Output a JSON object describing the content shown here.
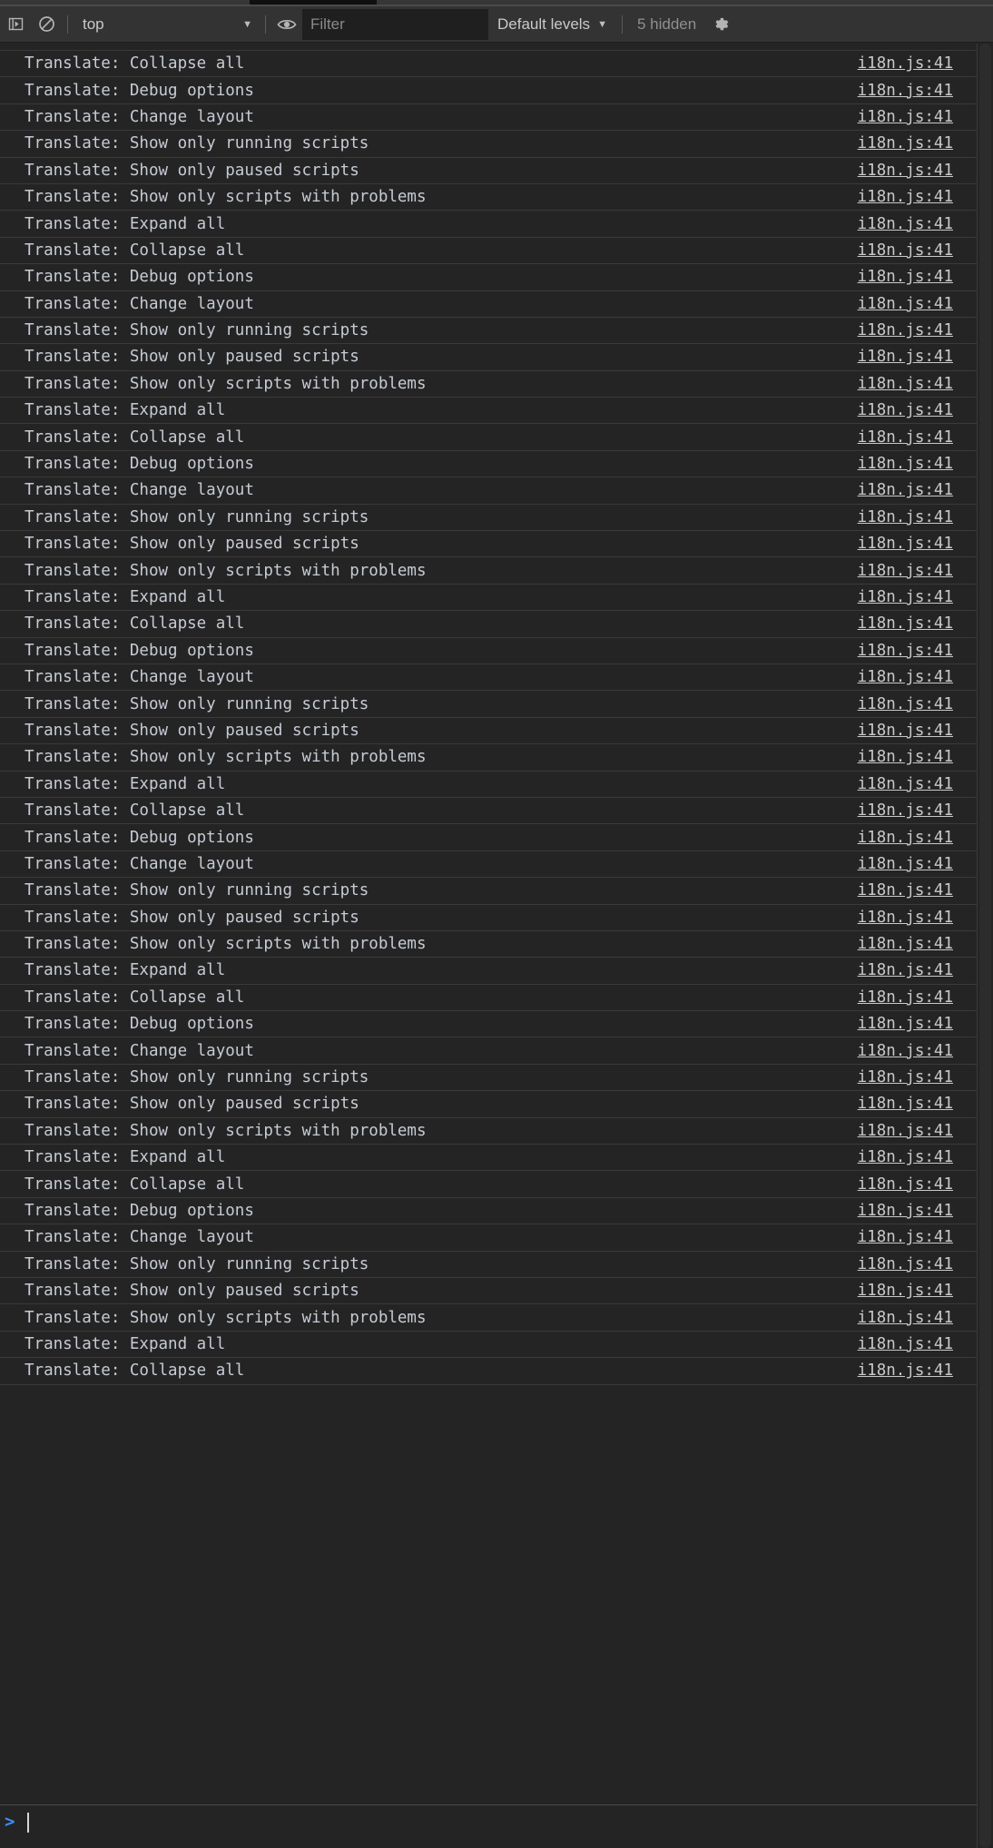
{
  "toolbar": {
    "sidebar_toggle_icon": "show-console-sidebar-icon",
    "clear_icon": "clear-console-icon",
    "context_selector": "top",
    "context_caret": "▼",
    "eye_icon": "create-live-expression-icon",
    "filter_placeholder": "Filter",
    "filter_value": "",
    "levels_label": "Default levels",
    "levels_caret": "▼",
    "hidden_label": "5 hidden",
    "settings_icon": "gear-icon"
  },
  "colors": {
    "toolbar_bg": "#333333",
    "console_bg": "#242424",
    "row_border": "#3a3a3a",
    "message_text": "#c6cbd4",
    "link_text": "#c8c8c8",
    "prompt_chevron": "#3d8ff5",
    "placeholder": "#8a8a8a"
  },
  "console": {
    "source_link": "i18n.js:41",
    "message_prefix": "Translate: ",
    "cycle": [
      "Translate: Collapse all",
      "Translate: Debug options",
      "Translate: Change layout",
      "Translate: Show only running scripts",
      "Translate: Show only paused scripts",
      "Translate: Show only scripts with problems",
      "Translate: Expand all"
    ],
    "messages": [
      "Translate: Collapse all",
      "Translate: Debug options",
      "Translate: Change layout",
      "Translate: Show only running scripts",
      "Translate: Show only paused scripts",
      "Translate: Show only scripts with problems",
      "Translate: Expand all",
      "Translate: Collapse all",
      "Translate: Debug options",
      "Translate: Change layout",
      "Translate: Show only running scripts",
      "Translate: Show only paused scripts",
      "Translate: Show only scripts with problems",
      "Translate: Expand all",
      "Translate: Collapse all",
      "Translate: Debug options",
      "Translate: Change layout",
      "Translate: Show only running scripts",
      "Translate: Show only paused scripts",
      "Translate: Show only scripts with problems",
      "Translate: Expand all",
      "Translate: Collapse all",
      "Translate: Debug options",
      "Translate: Change layout",
      "Translate: Show only running scripts",
      "Translate: Show only paused scripts",
      "Translate: Show only scripts with problems",
      "Translate: Expand all",
      "Translate: Collapse all",
      "Translate: Debug options",
      "Translate: Change layout",
      "Translate: Show only running scripts",
      "Translate: Show only paused scripts",
      "Translate: Show only scripts with problems",
      "Translate: Expand all",
      "Translate: Collapse all",
      "Translate: Debug options",
      "Translate: Change layout",
      "Translate: Show only running scripts",
      "Translate: Show only paused scripts",
      "Translate: Show only scripts with problems",
      "Translate: Expand all",
      "Translate: Collapse all",
      "Translate: Debug options",
      "Translate: Change layout",
      "Translate: Show only running scripts",
      "Translate: Show only paused scripts",
      "Translate: Show only scripts with problems",
      "Translate: Expand all",
      "Translate: Collapse all"
    ]
  },
  "prompt": {
    "chevron": ">",
    "input_value": ""
  }
}
